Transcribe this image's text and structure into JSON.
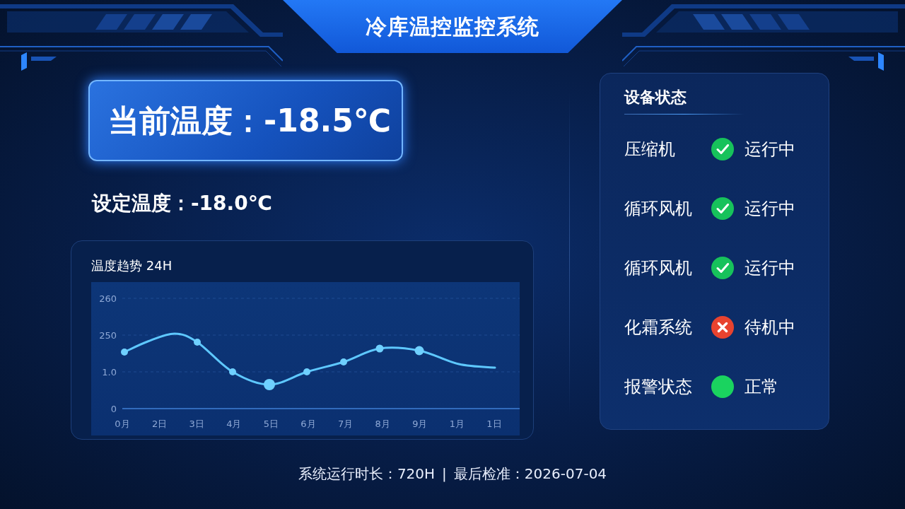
{
  "header": {
    "title": "冷库温控监控系统"
  },
  "current_temperature": {
    "text": "当前温度：-18.5℃"
  },
  "set_temperature": {
    "text": "设定温度：-18.0℃"
  },
  "trend": {
    "title": "温度趋势 24H",
    "y_axis_labels": [
      "260",
      "250",
      "1.0",
      "0"
    ],
    "x_axis_labels": [
      "0月",
      "2日",
      "3日",
      "4月",
      "5日",
      "6月",
      "7月",
      "8月",
      "9月",
      "1月",
      "1日"
    ]
  },
  "device_status": {
    "title": "设备状态",
    "items": [
      {
        "name": "压缩机",
        "kind": "running",
        "status": "运行中"
      },
      {
        "name": "循环风机",
        "kind": "running",
        "status": "运行中"
      },
      {
        "name": "循环风机",
        "kind": "running",
        "status": "运行中"
      },
      {
        "name": "化霜系统",
        "kind": "standby",
        "status": "待机中"
      },
      {
        "name": "报警状态",
        "kind": "normal",
        "status": "正常"
      }
    ]
  },
  "footer": {
    "runtime": "系统运行时长：720H",
    "separator": "|",
    "last_check": "最后检准：2026-07-04"
  }
}
